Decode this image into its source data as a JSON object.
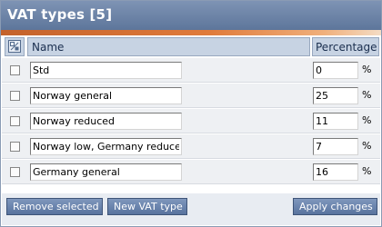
{
  "panel": {
    "title": "VAT types [5]"
  },
  "table": {
    "headers": {
      "name": "Name",
      "percentage": "Percentage"
    },
    "percent_sign": "%",
    "rows": [
      {
        "name": "Std",
        "percentage": "0"
      },
      {
        "name": "Norway general",
        "percentage": "25"
      },
      {
        "name": "Norway reduced",
        "percentage": "11"
      },
      {
        "name": "Norway low, Germany reduced",
        "percentage": "7"
      },
      {
        "name": "Germany general",
        "percentage": "16"
      }
    ]
  },
  "buttons": {
    "remove_selected": "Remove selected",
    "new_vat_type": "New VAT type",
    "apply_changes": "Apply changes"
  },
  "colors": {
    "title_bar": "#6b82a6",
    "accent_stripe": "#e07b3b",
    "header_cell": "#c7d3e3",
    "button": "#6a84ad"
  }
}
